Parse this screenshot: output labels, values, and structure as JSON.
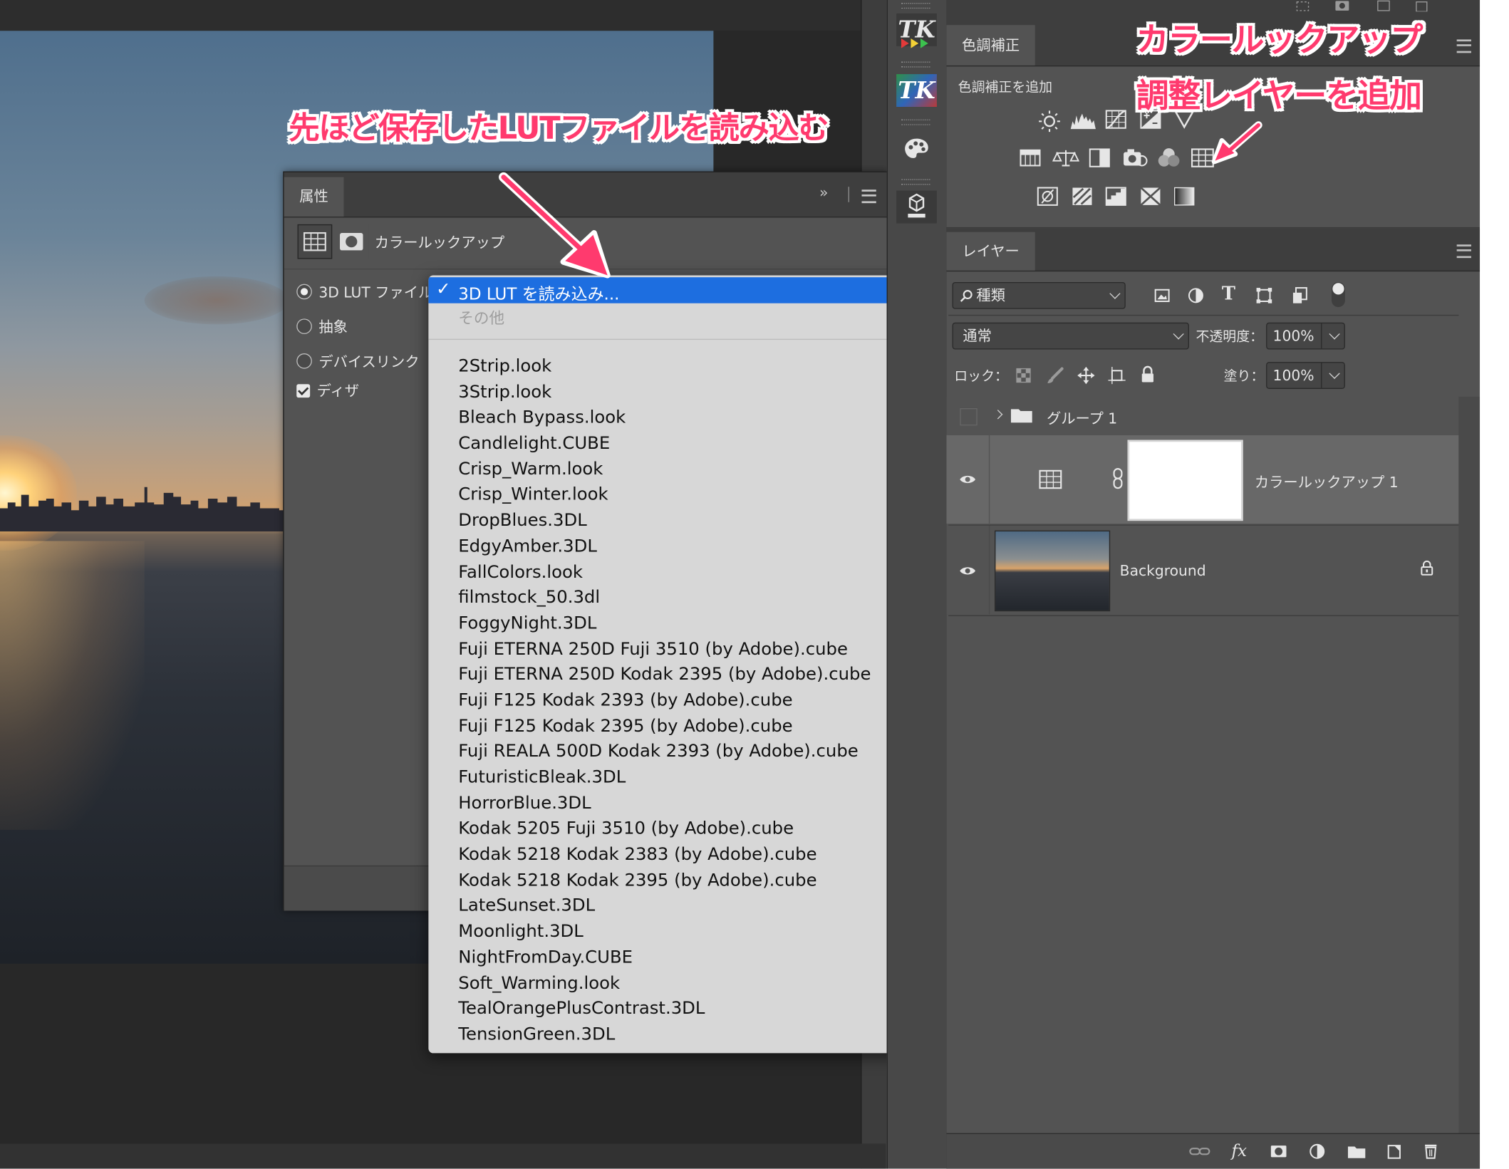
{
  "annotations": {
    "load_lut": "先ほど保存したLUTファイルを読み込む",
    "color_lookup": "カラールックアップ",
    "add_adjustment_layer": "調整レイヤーを追加"
  },
  "properties_panel": {
    "tab": "属性",
    "collapse_glyph": "»",
    "title": "カラールックアップ",
    "options": [
      {
        "label": "3D LUT ファイル",
        "type": "radio",
        "checked": true
      },
      {
        "label": "抽象",
        "type": "radio",
        "checked": false
      },
      {
        "label": "デバイスリンク",
        "type": "radio",
        "checked": false
      },
      {
        "label": "ディザ",
        "type": "checkbox",
        "checked": true
      }
    ]
  },
  "lut_dropdown": {
    "selected": "3D LUT を読み込み...",
    "other": "その他",
    "items": [
      "2Strip.look",
      "3Strip.look",
      "Bleach Bypass.look",
      "Candlelight.CUBE",
      "Crisp_Warm.look",
      "Crisp_Winter.look",
      "DropBlues.3DL",
      "EdgyAmber.3DL",
      "FallColors.look",
      "filmstock_50.3dl",
      "FoggyNight.3DL",
      "Fuji ETERNA 250D Fuji 3510 (by Adobe).cube",
      "Fuji ETERNA 250D Kodak 2395 (by Adobe).cube",
      "Fuji F125 Kodak 2393 (by Adobe).cube",
      "Fuji F125 Kodak 2395 (by Adobe).cube",
      "Fuji REALA 500D Kodak 2393 (by Adobe).cube",
      "FuturisticBleak.3DL",
      "HorrorBlue.3DL",
      "Kodak 5205 Fuji 3510 (by Adobe).cube",
      "Kodak 5218 Kodak 2383 (by Adobe).cube",
      "Kodak 5218 Kodak 2395 (by Adobe).cube",
      "LateSunset.3DL",
      "Moonlight.3DL",
      "NightFromDay.CUBE",
      "Soft_Warming.look",
      "TealOrangePlusContrast.3DL",
      "TensionGreen.3DL"
    ]
  },
  "toolstrip": {
    "tk1": "TK",
    "tk2": "TK"
  },
  "adjustments_panel": {
    "tab": "色調補正",
    "add_label": "色調補正を追加"
  },
  "layers_panel": {
    "tab": "レイヤー",
    "filter_kind": "種類",
    "blend_mode": "通常",
    "opacity_label": "不透明度：",
    "opacity_value": "100%",
    "lock_label": "ロック：",
    "fill_label": "塗り：",
    "fill_value": "100%",
    "layers": [
      {
        "name": "グループ 1",
        "type": "group"
      },
      {
        "name": "カラールックアップ 1",
        "type": "adjustment"
      },
      {
        "name": "Background",
        "type": "pixel"
      }
    ]
  },
  "colors": {
    "annotation": "#ff3a6e",
    "menu_highlight": "#1d6ee0",
    "panel_bg": "#535353"
  }
}
